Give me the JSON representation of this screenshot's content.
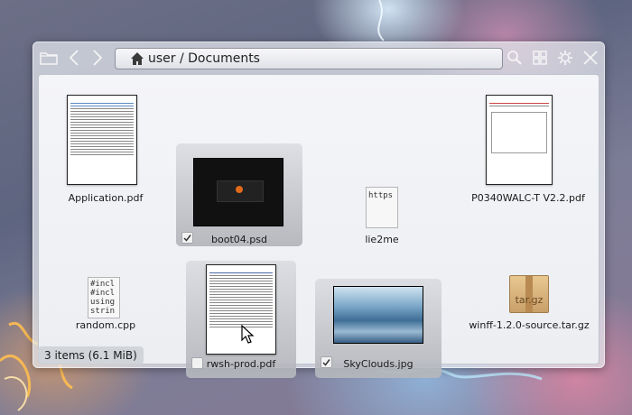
{
  "window": {
    "address_path": "user / Documents"
  },
  "files": [
    {
      "name": "Application.pdf",
      "type": "pdf",
      "selected": false
    },
    {
      "name": "boot04.psd",
      "type": "image",
      "selected": true,
      "checked": true
    },
    {
      "name": "lie2me",
      "type": "text",
      "icon_text": "https",
      "selected": false
    },
    {
      "name": "P0340WALC-T V2.2.pdf",
      "type": "pdf",
      "selected": false
    },
    {
      "name": "random.cpp",
      "type": "text",
      "icon_text": "#incl\n#incl\nusing\nstrin",
      "selected": false
    },
    {
      "name": "rwsh-prod.pdf",
      "type": "pdf",
      "selected": true,
      "checked": false
    },
    {
      "name": "SkyClouds.jpg",
      "type": "image",
      "selected": true,
      "checked": true
    },
    {
      "name": "winff-1.2.0-source.tar.gz",
      "type": "archive",
      "icon_text": "tar.gz",
      "selected": false
    }
  ],
  "status": {
    "text": "3 items (6.1 MiB)"
  },
  "icons": [
    "folder-icon",
    "back-icon",
    "forward-icon",
    "home-icon",
    "search-icon",
    "grid-view-icon",
    "settings-icon",
    "close-icon",
    "cursor-icon",
    "checkmark-icon"
  ]
}
